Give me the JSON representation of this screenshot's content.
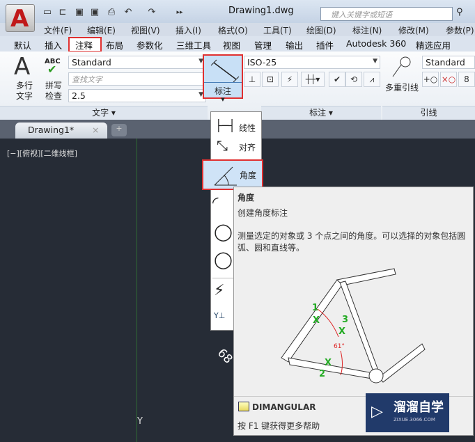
{
  "title_bar": {
    "app_logo": "A",
    "document_title": "Drawing1.dwg",
    "search_placeholder": "键入关键字或短语",
    "quick_access_icons": [
      "new-icon",
      "open-icon",
      "save-icon",
      "save-as-icon",
      "print-icon",
      "undo-icon",
      "redo-icon",
      "more-icon"
    ]
  },
  "menu": [
    "文件(F)",
    "编辑(E)",
    "视图(V)",
    "插入(I)",
    "格式(O)",
    "工具(T)",
    "绘图(D)",
    "标注(N)",
    "修改(M)",
    "参数(P)"
  ],
  "ribbon_tabs": [
    "默认",
    "插入",
    "注释",
    "布局",
    "参数化",
    "三维工具",
    "视图",
    "管理",
    "输出",
    "插件",
    "Autodesk 360",
    "精选应用"
  ],
  "selected_tab": "注释",
  "text_panel": {
    "mtext_label1": "多行",
    "mtext_label2": "文字",
    "spell_top": "ABC",
    "spell1": "拼写",
    "spell2": "检查",
    "style": "Standard",
    "find_placeholder": "查找文字",
    "height": "2.5",
    "panel_label": "文字 ▾"
  },
  "dim_panel": {
    "button_label": "标注",
    "style": "ISO-25",
    "panel_label": "标注 ▾"
  },
  "leader_panel": {
    "button_label": "多重引线",
    "style": "Standard",
    "panel_label": "引线"
  },
  "doc_tab": {
    "label": "Drawing1*",
    "close": "×"
  },
  "viewport_label": "[−][俯视][二维线框]",
  "canvas": {
    "dim_text": "68",
    "ucs_y": "Y"
  },
  "dropdown": {
    "items": [
      "线性",
      "对齐",
      "角度"
    ],
    "selected": "角度"
  },
  "tooltip": {
    "title": "角度",
    "subtitle": "创建角度标注",
    "description": "测量选定的对象或 3 个点之间的角度。可以选择的对象包括圆弧、圆和直线等。",
    "points": [
      "1",
      "2",
      "3"
    ],
    "angle": "61°",
    "command": "DIMANGULAR",
    "help": "按 F1 键获得更多帮助"
  },
  "watermark": {
    "name": "溜溜自学",
    "url": "ZIXUE.3066.COM"
  }
}
